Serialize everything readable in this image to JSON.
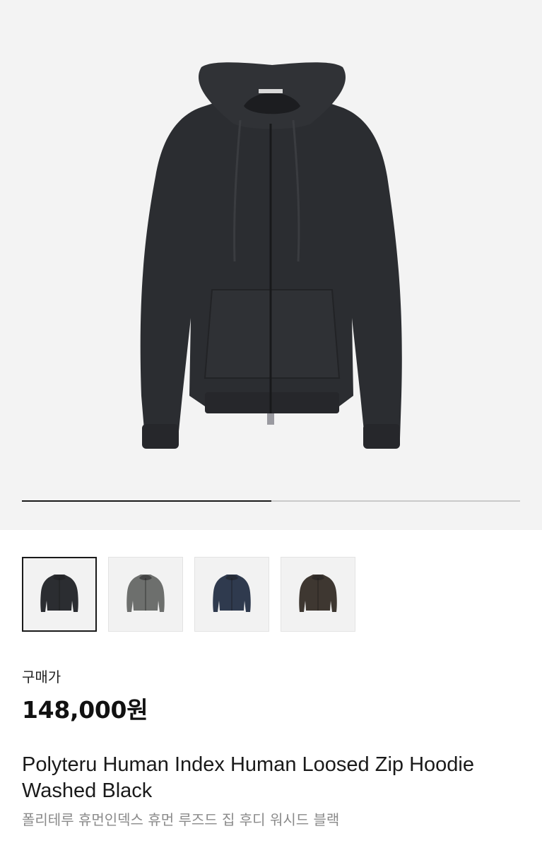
{
  "product": {
    "image_alt": "hoodie-photo",
    "gallery_progress": 0.5,
    "thumbnails": [
      {
        "color_name": "black",
        "color": "#2b2d31",
        "selected": true
      },
      {
        "color_name": "gray",
        "color": "#6d6f6d",
        "selected": false
      },
      {
        "color_name": "navy",
        "color": "#2f3a4e",
        "selected": false
      },
      {
        "color_name": "brown",
        "color": "#3e3731",
        "selected": false
      }
    ],
    "price_label": "구매가",
    "price": "148,000원",
    "title": "Polyteru Human Index Human Loosed Zip Hoodie Washed Black",
    "subtitle": "폴리테루 휴먼인덱스 휴먼 루즈드 집 후디 워시드 블랙"
  },
  "colors": {
    "hero_bg": "#f3f3f3",
    "hoodie": "#2b2d31",
    "progress_fill": "#1a1a1a",
    "progress_track": "#c9c9c9"
  }
}
